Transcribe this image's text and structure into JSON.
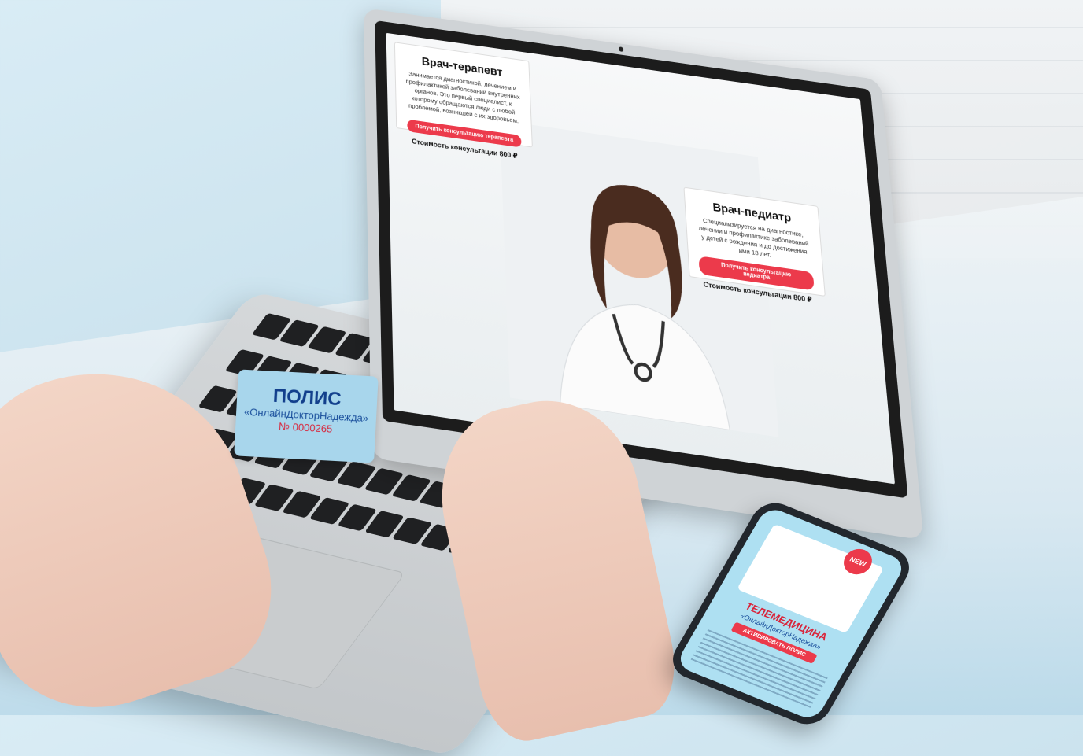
{
  "laptop_site": {
    "card_therapist": {
      "title": "Врач-терапевт",
      "description": "Занимается диагностикой, лечением и профилактикой заболеваний внутренних органов. Это первый специалист, к которому обращаются люди с любой проблемой, возникшей с их здоровьем.",
      "button": "Получить консультацию терапевта",
      "price": "Стоимость консультации 800 ₽"
    },
    "card_pediatric": {
      "title": "Врач-педиатр",
      "description": "Специализируется на диагностике, лечении и профилактике заболеваний у детей с рождения и до достижения ими 18 лет.",
      "button": "Получить консультацию педиатра",
      "price": "Стоимость консультации 800 ₽"
    }
  },
  "policy_card": {
    "title": "ПОЛИС",
    "name": "«ОнлайнДокторНадежда»",
    "number": "№ 0000265"
  },
  "phone": {
    "badge": "NEW",
    "title": "ТЕЛЕМЕДИЦИНА",
    "subtitle": "«ОнлайнДокторНадежда»",
    "button": "АКТИВИРОВАТЬ ПОЛИС"
  },
  "colors": {
    "accent_red": "#ec3a4b",
    "policy_blue": "#123f8c",
    "policy_card_bg": "#a8d6ec"
  }
}
